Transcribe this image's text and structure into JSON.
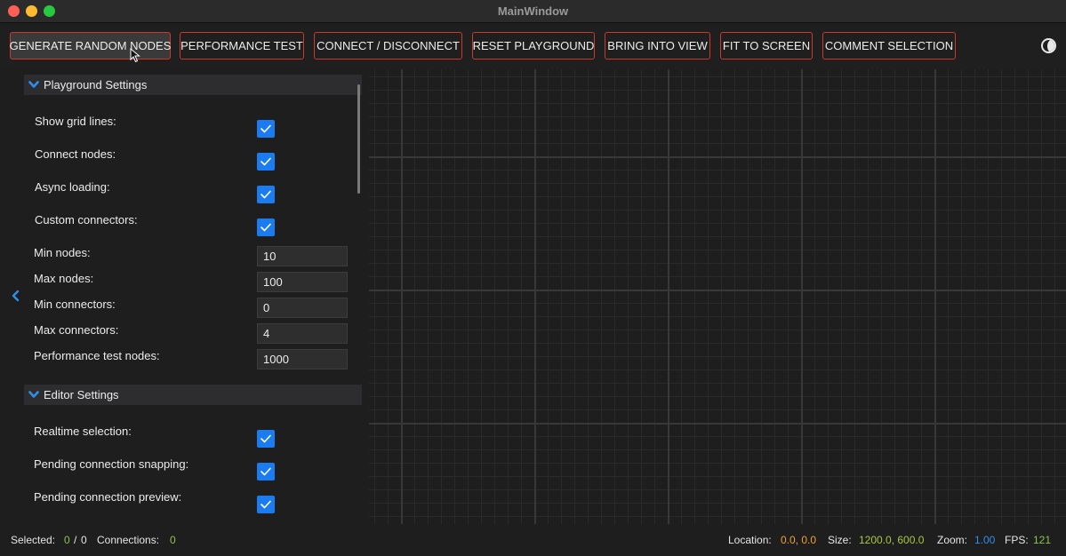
{
  "window": {
    "title": "MainWindow"
  },
  "toolbar": {
    "buttons": [
      "GENERATE RANDOM NODES",
      "PERFORMANCE TEST",
      "CONNECT / DISCONNECT",
      "RESET PLAYGROUND",
      "BRING INTO VIEW",
      "FIT TO SCREEN",
      "COMMENT SELECTION"
    ],
    "theme_icon": "theme-toggle-icon"
  },
  "playground": {
    "title": "Playground Settings",
    "show_grid_lines": {
      "label": "Show grid lines:",
      "checked": true
    },
    "connect_nodes": {
      "label": "Connect nodes:",
      "checked": true
    },
    "async_loading": {
      "label": "Async loading:",
      "checked": true
    },
    "custom_connectors": {
      "label": "Custom connectors:",
      "checked": true
    },
    "min_nodes": {
      "label": "Min nodes:",
      "value": "10"
    },
    "max_nodes": {
      "label": "Max nodes:",
      "value": "100"
    },
    "min_connectors": {
      "label": "Min connectors:",
      "value": "0"
    },
    "max_connectors": {
      "label": "Max connectors:",
      "value": "4"
    },
    "performance_test_nodes": {
      "label": "Performance test nodes:",
      "value": "1000"
    }
  },
  "editor": {
    "title": "Editor Settings",
    "realtime_selection": {
      "label": "Realtime selection:",
      "checked": true
    },
    "pending_snapping": {
      "label": "Pending connection snapping:",
      "checked": true
    },
    "pending_preview": {
      "label": "Pending connection preview:",
      "checked": true
    }
  },
  "status": {
    "selected_label": "Selected:",
    "selected_count": "0",
    "selected_sep": "/",
    "selected_total": "0",
    "connections_label": "Connections:",
    "connections_value": "0",
    "location_label": "Location:",
    "location_value": "0.0, 0.0",
    "size_label": "Size:",
    "size_value": "1200.0, 600.0",
    "zoom_label": "Zoom:",
    "zoom_value": "1.00",
    "fps_label": "FPS:",
    "fps_value": "121"
  },
  "colors": {
    "accent": "#1a7cf0",
    "button_border": "#c93a2a",
    "status_green": "#8bc34a",
    "status_orange": "#f0a030",
    "status_blue": "#2f8fe8"
  }
}
